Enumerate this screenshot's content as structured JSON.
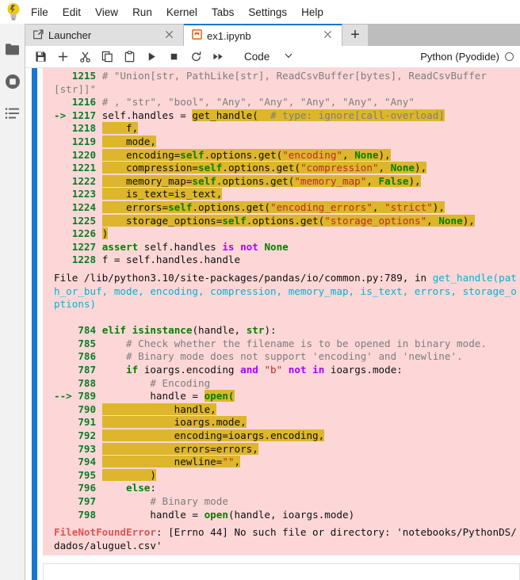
{
  "app": {
    "logo_icon": "jupyter-logo-icon",
    "menus": [
      "File",
      "Edit",
      "View",
      "Run",
      "Kernel",
      "Tabs",
      "Settings",
      "Help"
    ]
  },
  "sidebar": {
    "items": [
      {
        "name": "file-browser",
        "icon": "folder-icon"
      },
      {
        "name": "running-kernels",
        "icon": "stop-circle-icon"
      },
      {
        "name": "table-of-contents",
        "icon": "list-icon"
      }
    ]
  },
  "tabs": [
    {
      "label": "Launcher",
      "icon": "launcher-icon",
      "active": false,
      "close_icon": "close-icon"
    },
    {
      "label": "ex1.ipynb",
      "icon": "notebook-icon",
      "active": true,
      "close_icon": "close-icon"
    }
  ],
  "new_tab_label": "+",
  "toolbar": {
    "buttons": [
      {
        "name": "save-button",
        "icon": "save-icon"
      },
      {
        "name": "insert-cell-button",
        "icon": "plus-icon"
      },
      {
        "name": "cut-cell-button",
        "icon": "scissors-icon"
      },
      {
        "name": "copy-cell-button",
        "icon": "copy-icon"
      },
      {
        "name": "paste-cell-button",
        "icon": "clipboard-icon"
      },
      {
        "name": "run-cell-button",
        "icon": "play-icon"
      },
      {
        "name": "interrupt-kernel-button",
        "icon": "stop-icon"
      },
      {
        "name": "restart-kernel-button",
        "icon": "restart-icon"
      },
      {
        "name": "restart-and-run-all-button",
        "icon": "fast-forward-icon"
      }
    ],
    "cell_type": "Code",
    "cell_type_chevron": "chevron-down-icon",
    "kernel_name": "Python (Pyodide)",
    "kernel_status_icon": "kernel-idle-circle-icon"
  },
  "output": {
    "traceback_blocks": [
      {
        "id": "block-1",
        "lines": [
          {
            "marker": "",
            "num": "1215",
            "segments": [
              {
                "t": "# \"Union[str, PathLike[str], ReadCsvBuffer[bytes], ReadCsvBuffer",
                "c": "cmt"
              }
            ]
          },
          {
            "marker": "",
            "num": "",
            "nopad": true,
            "segments": [
              {
                "t": "[str]]\"",
                "c": "cmt"
              }
            ]
          },
          {
            "marker": "",
            "num": "1216",
            "segments": [
              {
                "t": "# , \"str\", \"bool\", \"Any\", \"Any\", \"Any\", \"Any\", \"Any\"",
                "c": "cmt"
              }
            ]
          },
          {
            "marker": "->",
            "num": "1217",
            "segments": [
              {
                "t": "self.handles = ",
                "c": "plain"
              },
              {
                "t": "get_handle(  ",
                "c": "plain hl"
              },
              {
                "t": "# type: ignore[call-overload]",
                "c": "cmt hl"
              }
            ]
          },
          {
            "marker": "",
            "num": "1218",
            "segments": [
              {
                "t": "    f,",
                "c": "plain hl"
              }
            ]
          },
          {
            "marker": "",
            "num": "1219",
            "segments": [
              {
                "t": "    mode,",
                "c": "plain hl"
              }
            ]
          },
          {
            "marker": "",
            "num": "1220",
            "segments": [
              {
                "t": "    encoding=",
                "c": "plain hl"
              },
              {
                "t": "self",
                "c": "kw hl"
              },
              {
                "t": ".options.get(",
                "c": "plain hl"
              },
              {
                "t": "\"encoding\"",
                "c": "str hl"
              },
              {
                "t": ", ",
                "c": "plain hl"
              },
              {
                "t": "None",
                "c": "kw hl"
              },
              {
                "t": "),",
                "c": "plain hl"
              }
            ]
          },
          {
            "marker": "",
            "num": "1221",
            "segments": [
              {
                "t": "    compression=",
                "c": "plain hl"
              },
              {
                "t": "self",
                "c": "kw hl"
              },
              {
                "t": ".options.get(",
                "c": "plain hl"
              },
              {
                "t": "\"compression\"",
                "c": "str hl"
              },
              {
                "t": ", ",
                "c": "plain hl"
              },
              {
                "t": "None",
                "c": "kw hl"
              },
              {
                "t": "),",
                "c": "plain hl"
              }
            ]
          },
          {
            "marker": "",
            "num": "1222",
            "segments": [
              {
                "t": "    memory_map=",
                "c": "plain hl"
              },
              {
                "t": "self",
                "c": "kw hl"
              },
              {
                "t": ".options.get(",
                "c": "plain hl"
              },
              {
                "t": "\"memory_map\"",
                "c": "str hl"
              },
              {
                "t": ", ",
                "c": "plain hl"
              },
              {
                "t": "False",
                "c": "kw hl"
              },
              {
                "t": "),",
                "c": "plain hl"
              }
            ]
          },
          {
            "marker": "",
            "num": "1223",
            "segments": [
              {
                "t": "    is_text=is_text,",
                "c": "plain hl"
              }
            ]
          },
          {
            "marker": "",
            "num": "1224",
            "segments": [
              {
                "t": "    errors=",
                "c": "plain hl"
              },
              {
                "t": "self",
                "c": "kw hl"
              },
              {
                "t": ".options.get(",
                "c": "plain hl"
              },
              {
                "t": "\"encoding_errors\"",
                "c": "str hl"
              },
              {
                "t": ", ",
                "c": "plain hl"
              },
              {
                "t": "\"strict\"",
                "c": "str hl"
              },
              {
                "t": "),",
                "c": "plain hl"
              }
            ]
          },
          {
            "marker": "",
            "num": "1225",
            "segments": [
              {
                "t": "    storage_options=",
                "c": "plain hl"
              },
              {
                "t": "self",
                "c": "kw hl"
              },
              {
                "t": ".options.get(",
                "c": "plain hl"
              },
              {
                "t": "\"storage_options\"",
                "c": "str hl"
              },
              {
                "t": ", ",
                "c": "plain hl"
              },
              {
                "t": "None",
                "c": "kw hl"
              },
              {
                "t": "),",
                "c": "plain hl"
              }
            ]
          },
          {
            "marker": "",
            "num": "1226",
            "segments": [
              {
                "t": ")",
                "c": "plain hl"
              }
            ]
          },
          {
            "marker": "",
            "num": "1227",
            "segments": [
              {
                "t": "assert",
                "c": "kw"
              },
              {
                "t": " self.handles ",
                "c": "plain"
              },
              {
                "t": "is not",
                "c": "kw2"
              },
              {
                "t": " ",
                "c": "plain"
              },
              {
                "t": "None",
                "c": "kw"
              }
            ]
          },
          {
            "marker": "",
            "num": "1228",
            "segments": [
              {
                "t": "f = self.handles.handle",
                "c": "plain"
              }
            ]
          }
        ]
      },
      {
        "id": "block-2",
        "file_line": [
          {
            "t": "File ",
            "c": "plain"
          },
          {
            "t": "/lib/python3.10/site-packages/pandas/io/common.py:789",
            "c": "plain"
          },
          {
            "t": ", in ",
            "c": "plain"
          },
          {
            "t": "get_handle(path_or_buf, mode, encoding, compression, memory_map, is_text, errors, storage_options)",
            "c": "cyan"
          }
        ],
        "lines": [
          {
            "marker": "",
            "num": "784",
            "segments": [
              {
                "t": "elif",
                "c": "kw"
              },
              {
                "t": " ",
                "c": "plain"
              },
              {
                "t": "isinstance",
                "c": "bi"
              },
              {
                "t": "(handle, ",
                "c": "plain"
              },
              {
                "t": "str",
                "c": "bi"
              },
              {
                "t": "):",
                "c": "plain"
              }
            ]
          },
          {
            "marker": "",
            "num": "785",
            "segments": [
              {
                "t": "    # Check whether the filename is to be opened in binary mode.",
                "c": "cmt"
              }
            ]
          },
          {
            "marker": "",
            "num": "786",
            "segments": [
              {
                "t": "    # Binary mode does not support 'encoding' and 'newline'.",
                "c": "cmt"
              }
            ]
          },
          {
            "marker": "",
            "num": "787",
            "segments": [
              {
                "t": "    ",
                "c": "plain"
              },
              {
                "t": "if",
                "c": "kw"
              },
              {
                "t": " ioargs.encoding ",
                "c": "plain"
              },
              {
                "t": "and",
                "c": "kw2"
              },
              {
                "t": " ",
                "c": "plain"
              },
              {
                "t": "\"b\"",
                "c": "str"
              },
              {
                "t": " ",
                "c": "plain"
              },
              {
                "t": "not in",
                "c": "kw2"
              },
              {
                "t": " ioargs.mode:",
                "c": "plain"
              }
            ]
          },
          {
            "marker": "",
            "num": "788",
            "segments": [
              {
                "t": "        # Encoding",
                "c": "cmt"
              }
            ]
          },
          {
            "marker": "-->",
            "num": "789",
            "segments": [
              {
                "t": "        handle = ",
                "c": "plain"
              },
              {
                "t": "open(",
                "c": "kw hl"
              }
            ]
          },
          {
            "marker": "",
            "num": "790",
            "segments": [
              {
                "t": "            handle,",
                "c": "plain hl"
              }
            ]
          },
          {
            "marker": "",
            "num": "791",
            "segments": [
              {
                "t": "            ioargs.mode,",
                "c": "plain hl"
              }
            ]
          },
          {
            "marker": "",
            "num": "792",
            "segments": [
              {
                "t": "            encoding=ioargs.encoding,",
                "c": "plain hl"
              }
            ]
          },
          {
            "marker": "",
            "num": "793",
            "segments": [
              {
                "t": "            errors=errors,",
                "c": "plain hl"
              }
            ]
          },
          {
            "marker": "",
            "num": "794",
            "segments": [
              {
                "t": "            newline=",
                "c": "plain hl"
              },
              {
                "t": "\"\"",
                "c": "str hl"
              },
              {
                "t": ",",
                "c": "plain hl"
              }
            ]
          },
          {
            "marker": "",
            "num": "795",
            "segments": [
              {
                "t": "        )",
                "c": "plain hl"
              }
            ]
          },
          {
            "marker": "",
            "num": "796",
            "segments": [
              {
                "t": "    ",
                "c": "plain"
              },
              {
                "t": "else",
                "c": "kw"
              },
              {
                "t": ":",
                "c": "plain"
              }
            ]
          },
          {
            "marker": "",
            "num": "797",
            "segments": [
              {
                "t": "        # Binary mode",
                "c": "cmt"
              }
            ]
          },
          {
            "marker": "",
            "num": "798",
            "segments": [
              {
                "t": "        handle = ",
                "c": "plain"
              },
              {
                "t": "open",
                "c": "kw"
              },
              {
                "t": "(handle, ioargs.mode)",
                "c": "plain"
              }
            ]
          }
        ]
      }
    ],
    "error": {
      "type": "FileNotFoundError",
      "message": ": [Errno 44] No such file or directory: 'notebooks/PythonDS/dados/aluguel.csv'"
    }
  },
  "colors": {
    "highlight": "#ddb62b",
    "error_bg": "#fdd7d7",
    "accent_blue": "#1976d2",
    "notebook_orange": "#e8610a",
    "logo_yellow": "#f2c811"
  }
}
